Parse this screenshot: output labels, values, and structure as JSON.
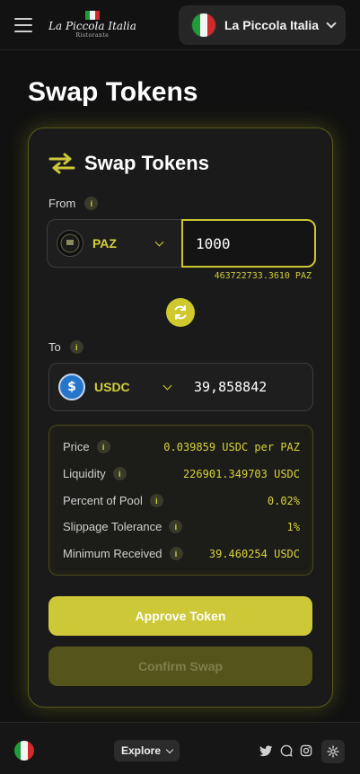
{
  "header": {
    "brand_name": "La Piccola Italia",
    "brand_sub": "Ristorante",
    "account_name": "La Piccola Italia"
  },
  "page": {
    "title": "Swap Tokens"
  },
  "card": {
    "title": "Swap Tokens",
    "from_label": "From",
    "from_token": "PAZ",
    "from_amount": "1000",
    "from_balance": "463722733.3610 PAZ",
    "to_label": "To",
    "to_token": "USDC",
    "to_amount": "39,858842"
  },
  "details": {
    "price_label": "Price",
    "price_value": "0.039859 USDC per PAZ",
    "liquidity_label": "Liquidity",
    "liquidity_value": "226901.349703 USDC",
    "pool_label": "Percent of Pool",
    "pool_value": "0.02%",
    "slippage_label": "Slippage Tolerance",
    "slippage_value": "1%",
    "min_label": "Minimum Received",
    "min_value": "39.460254 USDC"
  },
  "buttons": {
    "approve": "Approve Token",
    "confirm": "Confirm Swap"
  },
  "footer": {
    "explore": "Explore"
  },
  "info_glyph": "i",
  "colors": {
    "accent": "#ccc838",
    "accent_dim": "#55541a",
    "background": "#111111",
    "card": "#1a1a1a",
    "flag_green": "#1f9d3a",
    "flag_white": "#f4f4f4",
    "flag_red": "#d12a2a",
    "usdc_blue": "#2775ca"
  }
}
